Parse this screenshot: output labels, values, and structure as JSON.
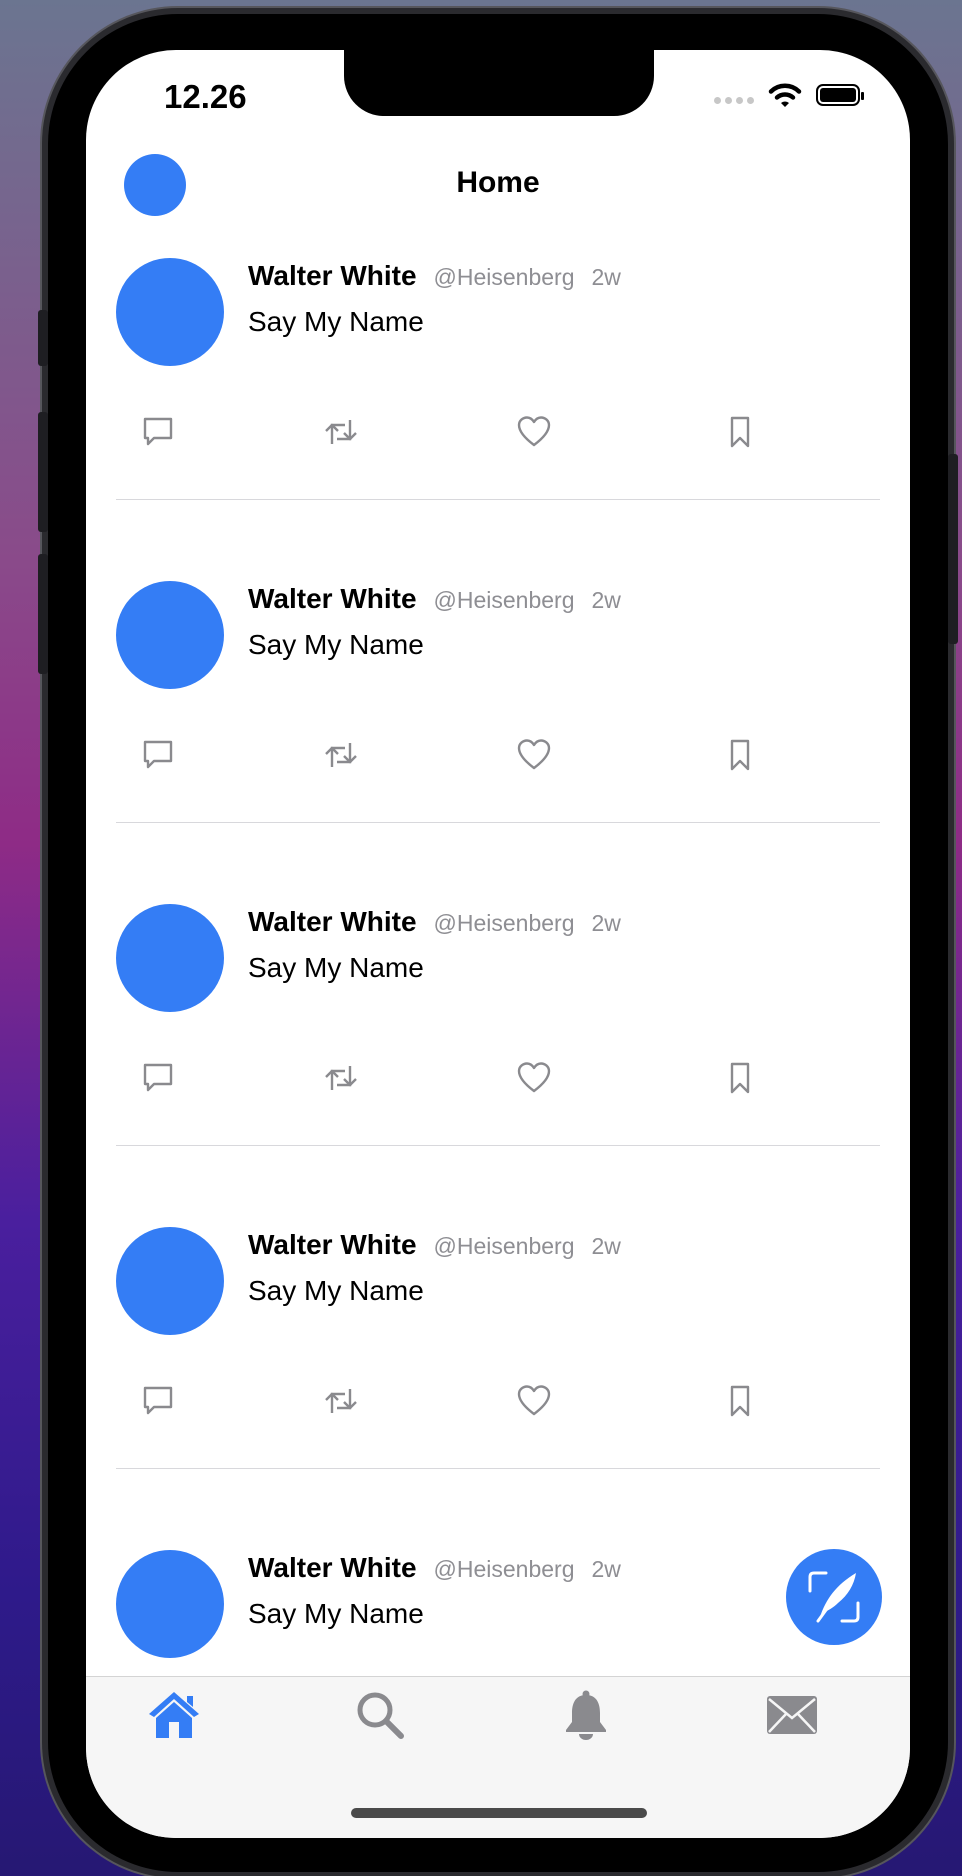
{
  "status_bar": {
    "time": "12.26"
  },
  "header": {
    "title": "Home"
  },
  "tweets": [
    {
      "name": "Walter White",
      "handle": "@Heisenberg",
      "time": "2w",
      "text": "Say My Name"
    },
    {
      "name": "Walter White",
      "handle": "@Heisenberg",
      "time": "2w",
      "text": "Say My Name"
    },
    {
      "name": "Walter White",
      "handle": "@Heisenberg",
      "time": "2w",
      "text": "Say My Name"
    },
    {
      "name": "Walter White",
      "handle": "@Heisenberg",
      "time": "2w",
      "text": "Say My Name"
    },
    {
      "name": "Walter White",
      "handle": "@Heisenberg",
      "time": "2w",
      "text": "Say My Name"
    }
  ],
  "tweet_action_icons": [
    "comment-icon",
    "retweet-icon",
    "like-icon",
    "bookmark-icon"
  ],
  "fab": {
    "icon": "feather-compose-icon"
  },
  "tab_bar": {
    "items": [
      {
        "icon": "house-icon",
        "selected": true
      },
      {
        "icon": "magnifying-glass-icon",
        "selected": false
      },
      {
        "icon": "bell-icon",
        "selected": false
      },
      {
        "icon": "envelope-icon",
        "selected": false
      }
    ]
  },
  "colors": {
    "accent": "#347df5",
    "secondary_text": "#8e8e93",
    "icon_gray": "#8a8a8e",
    "divider": "#d8d8dc",
    "tab_bar_background": "#f6f6f6"
  }
}
